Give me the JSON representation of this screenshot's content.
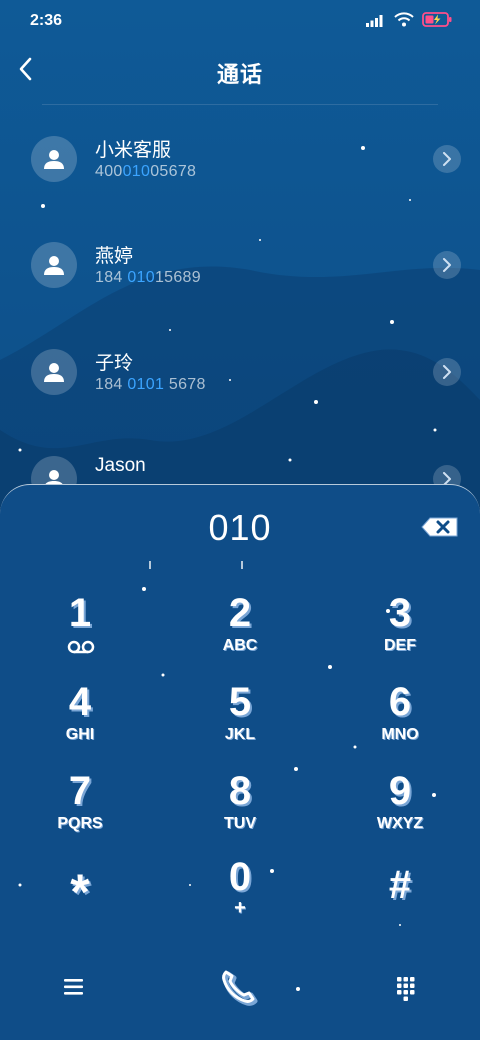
{
  "status": {
    "time": "2:36"
  },
  "header": {
    "title": "通话"
  },
  "contacts": [
    {
      "name": "小米客服",
      "num_pre": "400",
      "num_match": "010",
      "num_post": "05678"
    },
    {
      "name": "燕婷",
      "num_pre": "184 ",
      "num_match": "010",
      "num_post": "15689"
    },
    {
      "name": "子玲",
      "num_pre": "184 ",
      "num_match": "0101",
      "num_post": " 5678"
    },
    {
      "name": "Jason",
      "num_pre": "",
      "num_match": "",
      "num_post": ""
    }
  ],
  "dial": {
    "number": "010"
  },
  "keys": [
    {
      "digit": "1",
      "letters": ""
    },
    {
      "digit": "2",
      "letters": "ABC"
    },
    {
      "digit": "3",
      "letters": "DEF"
    },
    {
      "digit": "4",
      "letters": "GHI"
    },
    {
      "digit": "5",
      "letters": "JKL"
    },
    {
      "digit": "6",
      "letters": "MNO"
    },
    {
      "digit": "7",
      "letters": "PQRS"
    },
    {
      "digit": "8",
      "letters": "TUV"
    },
    {
      "digit": "9",
      "letters": "WXYZ"
    },
    {
      "digit": "*",
      "letters": ""
    },
    {
      "digit": "0",
      "letters": "+"
    },
    {
      "digit": "#",
      "letters": ""
    }
  ],
  "icons": {
    "back": "chevron-left-icon",
    "delete": "backspace-icon",
    "menu": "menu-icon",
    "call": "phone-icon",
    "keypad": "keypad-icon"
  },
  "colors": {
    "background": "#0d4a82",
    "highlight": "#3ba4ff"
  }
}
